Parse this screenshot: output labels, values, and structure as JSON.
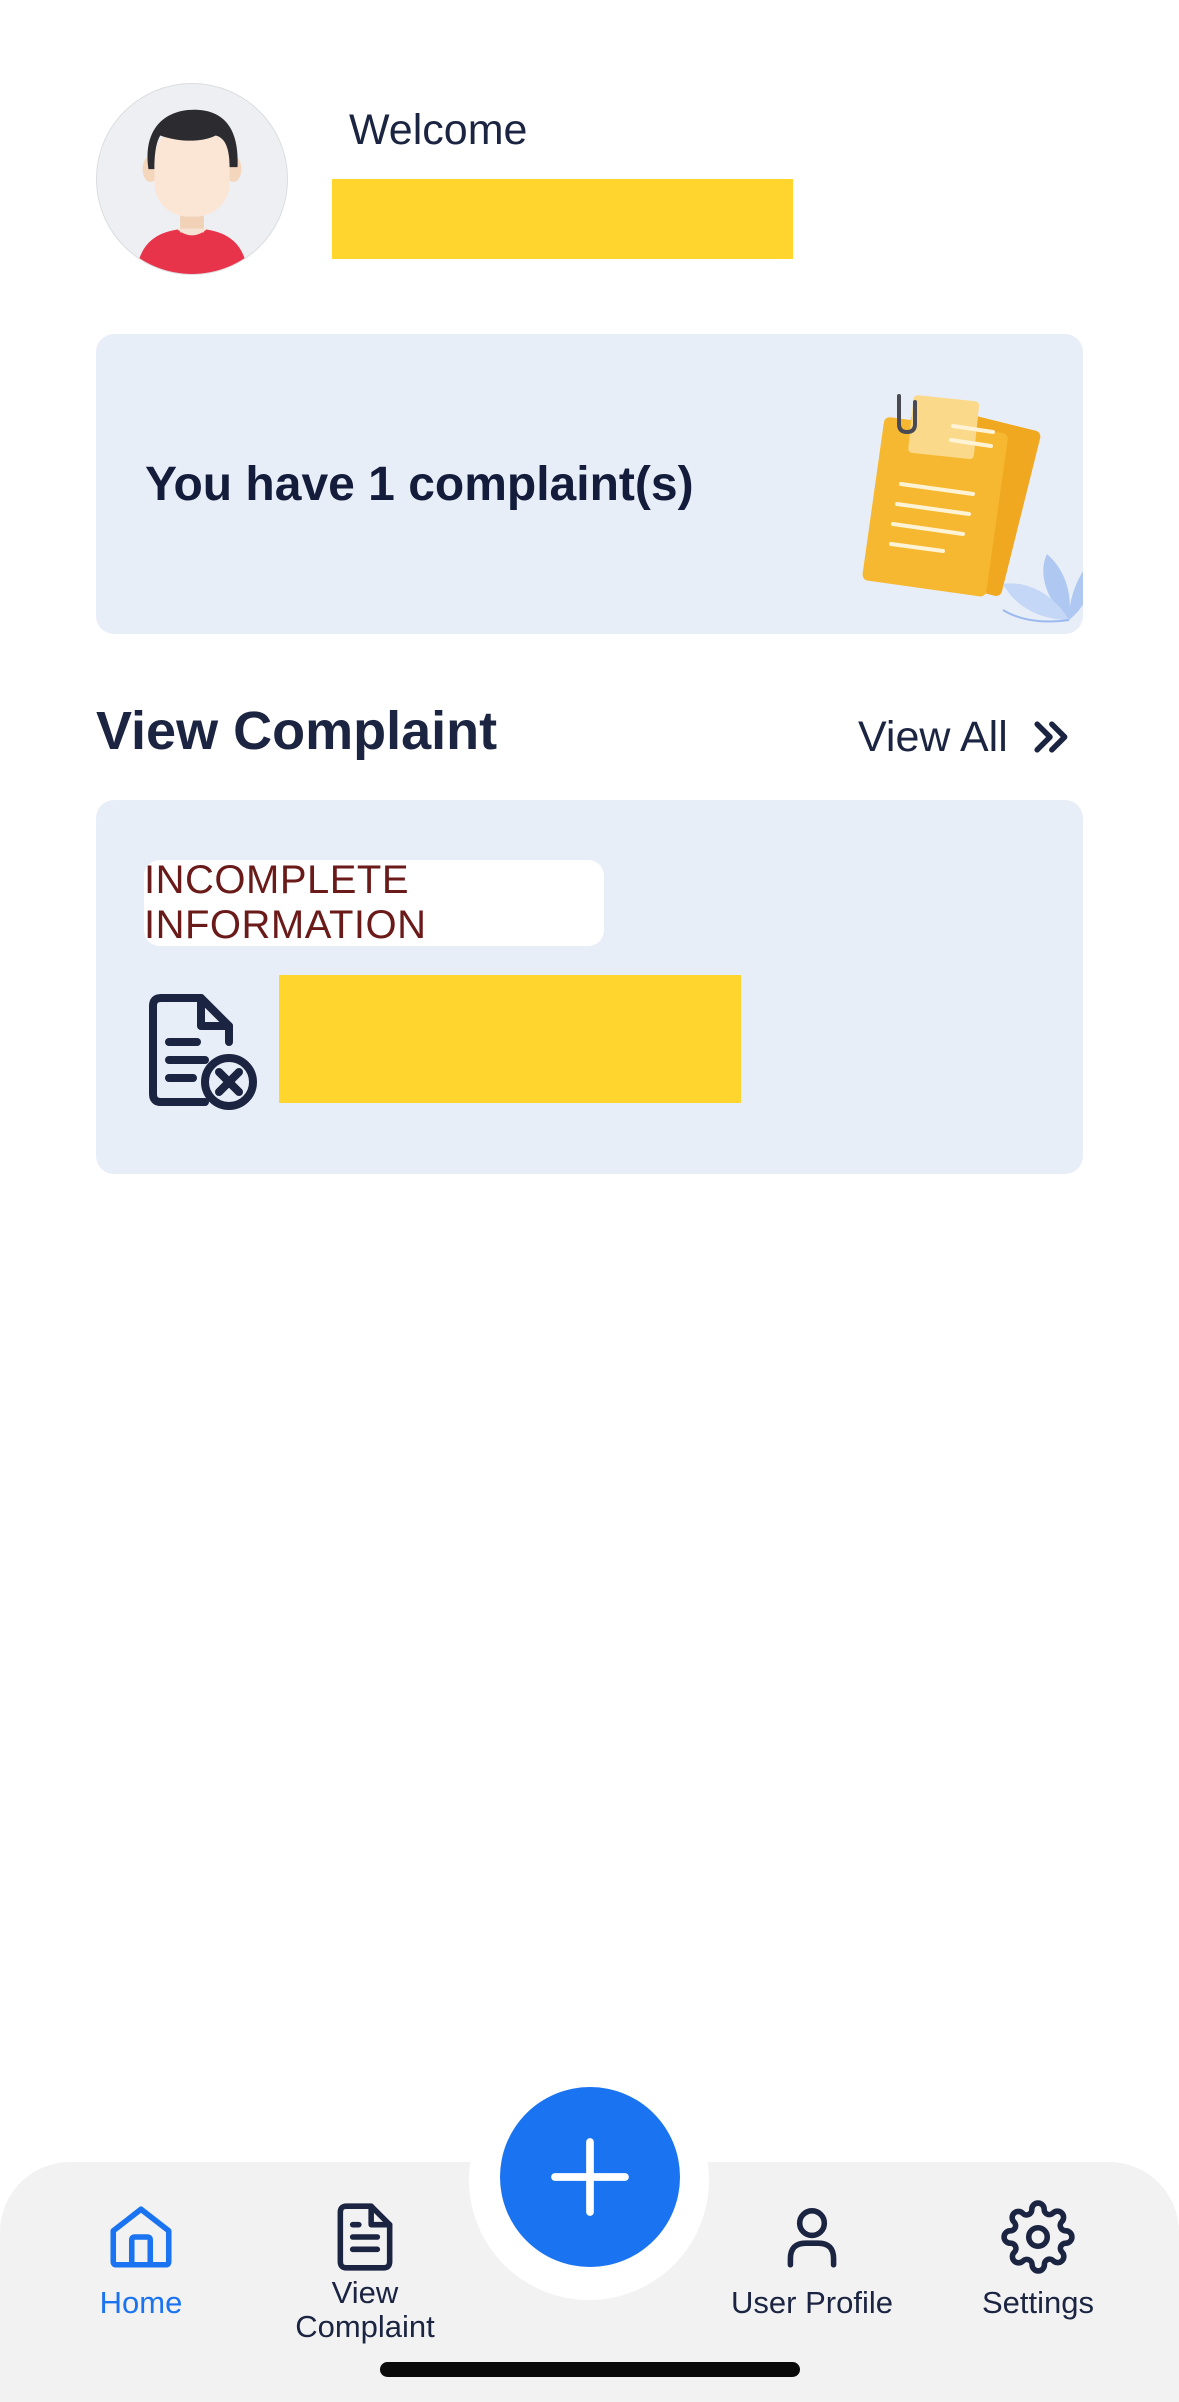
{
  "header": {
    "greeting": "Welcome",
    "avatar_icon": "user-avatar-icon"
  },
  "summary": {
    "text": "You have 1 complaint(s)",
    "illustration_icon": "documents-illustration"
  },
  "section": {
    "title": "View Complaint",
    "view_all_label": "View All",
    "view_all_icon": "chevrons-right-icon"
  },
  "complaints": [
    {
      "status": "INCOMPLETE INFORMATION",
      "icon": "file-x-icon"
    }
  ],
  "fab": {
    "icon": "plus-icon"
  },
  "bottom_nav": {
    "items": [
      {
        "label": "Home",
        "icon": "home-icon",
        "active": true
      },
      {
        "label": "View Complaint",
        "icon": "file-text-icon",
        "active": false
      },
      {
        "label": "User Profile",
        "icon": "user-icon",
        "active": false
      },
      {
        "label": "Settings",
        "icon": "gear-icon",
        "active": false
      }
    ]
  },
  "colors": {
    "accent": "#1a73f0",
    "card_background": "#e8eef8",
    "redaction": "#ffd52e",
    "status_text": "#6b1a1a",
    "text_primary": "#1b2440"
  }
}
